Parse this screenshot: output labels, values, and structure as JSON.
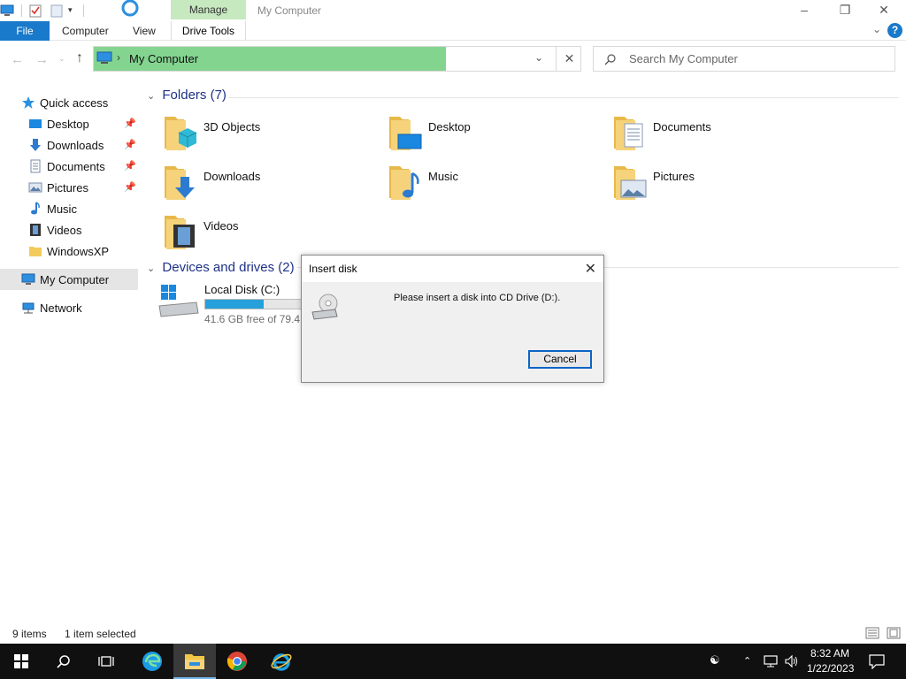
{
  "titlebar": {
    "manage_tab": "Manage",
    "window_title": "My Computer"
  },
  "ribbon": {
    "file": "File",
    "computer": "Computer",
    "view": "View",
    "drive_tools": "Drive Tools"
  },
  "address": {
    "path": "My Computer",
    "search_placeholder": "Search My Computer"
  },
  "navpane": {
    "quick_access": "Quick access",
    "items": [
      {
        "label": "Desktop",
        "pinned": true
      },
      {
        "label": "Downloads",
        "pinned": true
      },
      {
        "label": "Documents",
        "pinned": true
      },
      {
        "label": "Pictures",
        "pinned": true
      },
      {
        "label": "Music",
        "pinned": false
      },
      {
        "label": "Videos",
        "pinned": false
      },
      {
        "label": "WindowsXP",
        "pinned": false
      }
    ],
    "my_computer": "My Computer",
    "network": "Network"
  },
  "content": {
    "folders_header": "Folders (7)",
    "folders": [
      "3D Objects",
      "Desktop",
      "Documents",
      "Downloads",
      "Music",
      "Pictures",
      "Videos"
    ],
    "devices_header": "Devices and drives (2)",
    "drive": {
      "label": "Local Disk (C:)",
      "free_text": "41.6 GB free of 79.4 GB",
      "used_fraction": 0.48
    }
  },
  "statusbar": {
    "items": "9 items",
    "selected": "1 item selected"
  },
  "dialog": {
    "title": "Insert disk",
    "message": "Please insert a disk into CD Drive (D:).",
    "cancel": "Cancel"
  },
  "taskbar": {
    "time": "8:32 AM",
    "date": "1/22/2023"
  },
  "colors": {
    "accent": "#1979ca",
    "address_highlight": "#83d48f",
    "manage_tab": "#c7e9c0",
    "taskbar": "#101010"
  }
}
